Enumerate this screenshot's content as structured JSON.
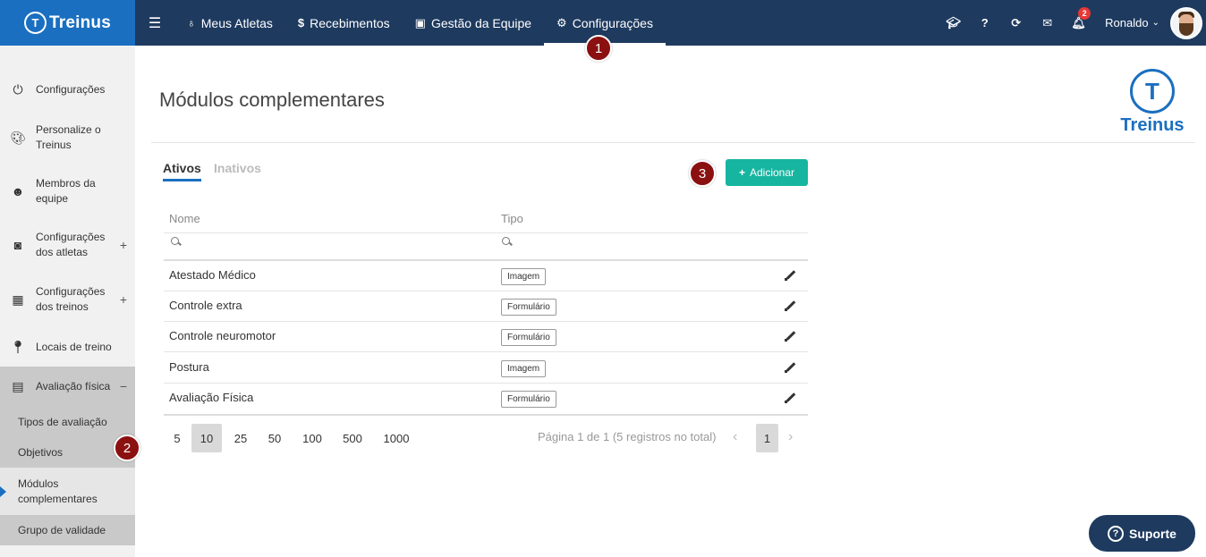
{
  "brand": {
    "name": "Treinus",
    "logo_letter": "T"
  },
  "nav": {
    "items": [
      {
        "label": "Meus Atletas",
        "icon": "medal-icon"
      },
      {
        "label": "Recebimentos",
        "icon": "dollar-icon"
      },
      {
        "label": "Gestão da Equipe",
        "icon": "id-card-icon"
      },
      {
        "label": "Configurações",
        "icon": "gears-icon",
        "active": true
      }
    ]
  },
  "topright": {
    "notifications_count": "2",
    "user_name": "Ronaldo"
  },
  "markers": {
    "m1": "1",
    "m2": "2",
    "m3": "3"
  },
  "sidebar": {
    "items": [
      {
        "label": "Configurações",
        "icon": "power-icon"
      },
      {
        "label": "Personalize o Treinus",
        "icon": "palette-icon"
      },
      {
        "label": "Membros da equipe",
        "icon": "team-icon"
      },
      {
        "label": "Configurações dos atletas",
        "icon": "athlete-badge-icon",
        "expand": "+"
      },
      {
        "label": "Configurações dos treinos",
        "icon": "table-gear-icon",
        "expand": "+"
      },
      {
        "label": "Locais de treino",
        "icon": "location-pin-icon"
      },
      {
        "label": "Avaliação física",
        "icon": "ruler-icon",
        "expand": "−"
      }
    ],
    "subitems": [
      {
        "label": "Tipos de avaliação"
      },
      {
        "label": "Objetivos"
      },
      {
        "label": "Módulos complementares",
        "current": true
      },
      {
        "label": "Grupo de validade"
      }
    ]
  },
  "main": {
    "title": "Módulos complementares",
    "tabs": [
      {
        "label": "Ativos",
        "active": true
      },
      {
        "label": "Inativos"
      }
    ],
    "add_button": "Adicionar",
    "columns": [
      "Nome",
      "Tipo"
    ],
    "rows": [
      {
        "name": "Atestado Médico",
        "type": "Imagem"
      },
      {
        "name": "Controle extra",
        "type": "Formulário"
      },
      {
        "name": "Controle neuromotor",
        "type": "Formulário"
      },
      {
        "name": "Postura",
        "type": "Imagem"
      },
      {
        "name": "Avaliação Física",
        "type": "Formulário"
      }
    ],
    "page_sizes": [
      "5",
      "10",
      "25",
      "50",
      "100",
      "500",
      "1000"
    ],
    "selected_page_size": "10",
    "page_info": "Página 1 de 1 (5 registros no total)",
    "current_page": "1"
  },
  "support": {
    "label": "Suporte"
  },
  "colors": {
    "topbar": "#1e3a5f",
    "brand": "#1a6fc0",
    "accent_teal": "#16b5a0",
    "marker": "#8b1010"
  }
}
